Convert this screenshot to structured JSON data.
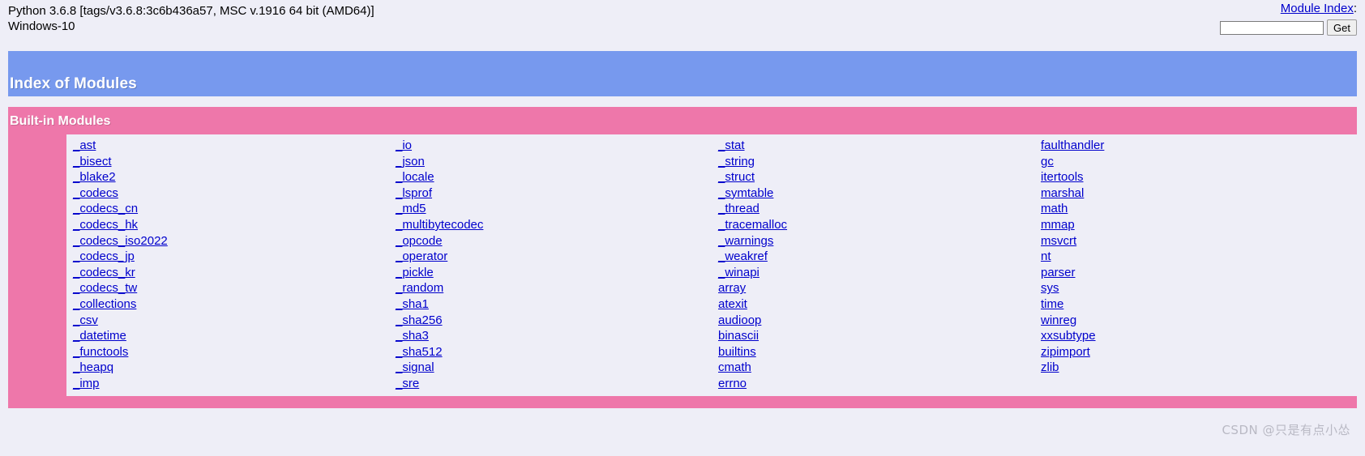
{
  "header": {
    "platform_line1": "Python 3.6.8 [tags/v3.6.8:3c6b436a57, MSC v.1916 64 bit (AMD64)]",
    "platform_line2": "Windows-10",
    "module_index_label": "Module Index",
    "colon": ":",
    "search_value": "",
    "search_placeholder": "",
    "get_button_label": "Get"
  },
  "page": {
    "title": "Index of Modules",
    "title_color": "#7799ee"
  },
  "builtin_section": {
    "title": "Built-in Modules",
    "banner_color": "#ee77aa",
    "link_color": "#0000cc",
    "columns": [
      [
        "_ast",
        "_bisect",
        "_blake2",
        "_codecs",
        "_codecs_cn",
        "_codecs_hk",
        "_codecs_iso2022",
        "_codecs_jp",
        "_codecs_kr",
        "_codecs_tw",
        "_collections",
        "_csv",
        "_datetime",
        "_functools",
        "_heapq",
        "_imp"
      ],
      [
        "_io",
        "_json",
        "_locale",
        "_lsprof",
        "_md5",
        "_multibytecodec",
        "_opcode",
        "_operator",
        "_pickle",
        "_random",
        "_sha1",
        "_sha256",
        "_sha3",
        "_sha512",
        "_signal",
        "_sre"
      ],
      [
        "_stat",
        "_string",
        "_struct",
        "_symtable",
        "_thread",
        "_tracemalloc",
        "_warnings",
        "_weakref",
        "_winapi",
        "array",
        "atexit",
        "audioop",
        "binascii",
        "builtins",
        "cmath",
        "errno"
      ],
      [
        "faulthandler",
        "gc",
        "itertools",
        "marshal",
        "math",
        "mmap",
        "msvcrt",
        "nt",
        "parser",
        "sys",
        "time",
        "winreg",
        "xxsubtype",
        "zipimport",
        "zlib"
      ]
    ]
  },
  "watermark": {
    "text": "CSDN @只是有点小怂"
  }
}
